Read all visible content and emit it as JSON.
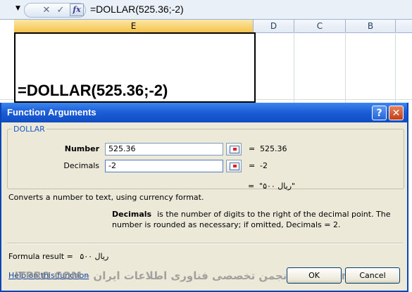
{
  "formula_bar": {
    "formula": "=DOLLAR(525.36;-2)",
    "fx_label": "fx",
    "cancel_glyph": "✕",
    "enter_glyph": "✓",
    "dropdown_glyph": "▼"
  },
  "sheet": {
    "columns": [
      "E",
      "D",
      "C",
      "B"
    ],
    "selected_column": "E",
    "active_cell_text": "=DOLLAR(525.36;-2)"
  },
  "dialog": {
    "title": "Function Arguments",
    "help_glyph": "?",
    "close_glyph": "✕",
    "function_name": "DOLLAR",
    "args": [
      {
        "label": "Number",
        "value": "525.36",
        "equals": "=",
        "result": "525.36"
      },
      {
        "label": "Decimals",
        "value": "-2",
        "equals": "=",
        "result": "-2"
      }
    ],
    "result_line": {
      "equals": "=",
      "value": "\"ریال ۵۰۰\""
    },
    "description": "Converts a number to text, using currency format.",
    "arg_help": {
      "name": "Decimals",
      "text": "is the number of digits to the right of the decimal point. The number is rounded as necessary; if omitted, Decimals = 2."
    },
    "formula_result": {
      "label": "Formula result =",
      "value": "ریال ۵۰۰"
    },
    "help_link": "Help on this function",
    "ok_label": "OK",
    "cancel_label": "Cancel",
    "watermark": "ITPro.ir - انجمن تخصصی فناوری اطلاعات ایران - ITPRO.COM"
  },
  "colors": {
    "title_blue": "#1d5fd7",
    "dialog_bg": "#ece9d8",
    "selected_header": "#f5c34b",
    "group_label": "#1c57c5"
  }
}
